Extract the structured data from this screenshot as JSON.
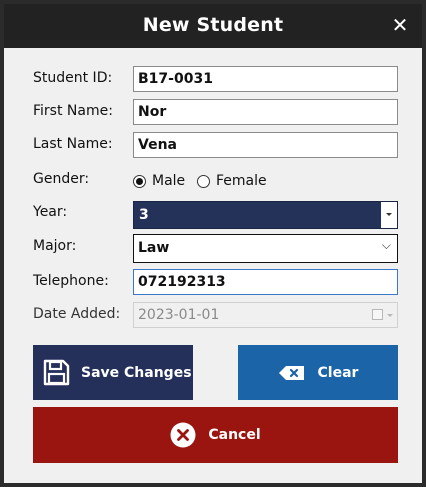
{
  "window": {
    "title": "New Student",
    "close_label": "✕"
  },
  "form": {
    "student_id": {
      "label": "Student ID:",
      "value": "B17-0031"
    },
    "first_name": {
      "label": "First Name:",
      "value": "Nor"
    },
    "last_name": {
      "label": "Last Name:",
      "value": "Vena"
    },
    "gender": {
      "label": "Gender:",
      "options": [
        "Male",
        "Female"
      ],
      "selected": "Male"
    },
    "year": {
      "label": "Year:",
      "value": "3"
    },
    "major": {
      "label": "Major:",
      "value": "Law"
    },
    "telephone": {
      "label": "Telephone:",
      "value": "072192313"
    },
    "date_added": {
      "label": "Date Added:",
      "value": "2023-01-01"
    }
  },
  "buttons": {
    "save_label": "Save Changes",
    "clear_label": "Clear",
    "cancel_label": "Cancel"
  },
  "colors": {
    "titlebar": "#222222",
    "year_select_bg": "#243158",
    "save_button": "#24305a",
    "clear_button": "#1c64a8",
    "cancel_button": "#9b1510",
    "focus_border": "#3b78c7"
  },
  "icons": {
    "save": "floppy-disk-icon",
    "clear": "backspace-icon",
    "cancel": "close-circle-icon"
  }
}
